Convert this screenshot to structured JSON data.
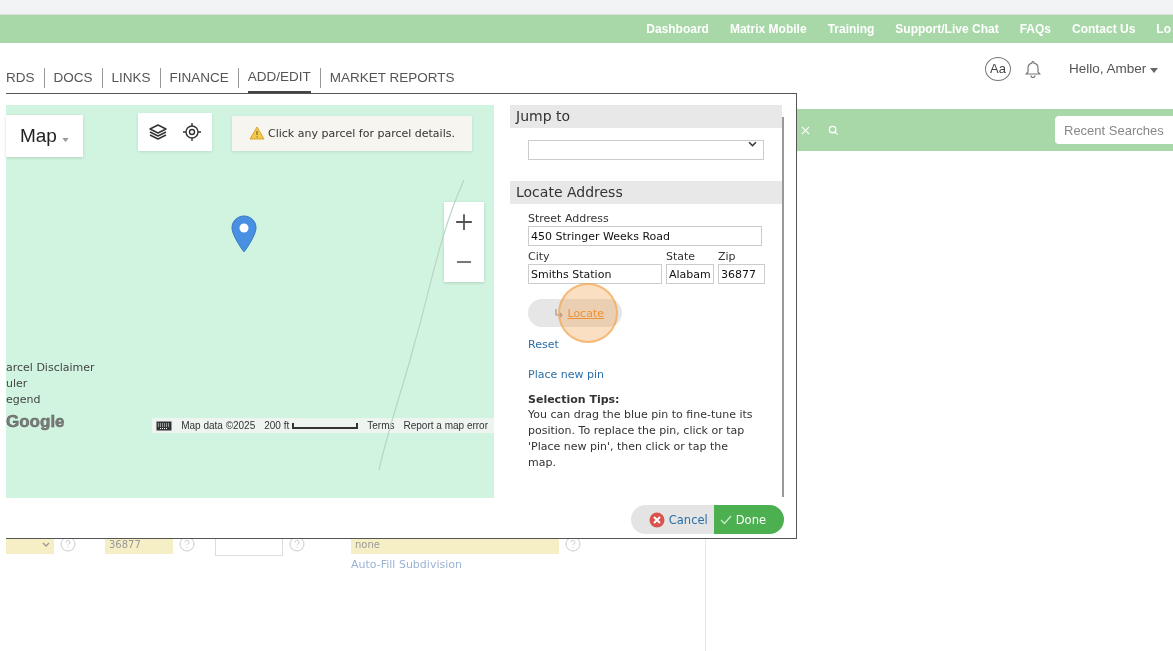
{
  "top_nav": {
    "links": [
      "Dashboard",
      "Matrix Mobile",
      "Training",
      "Support/Live Chat",
      "FAQs",
      "Contact Us",
      "Lo"
    ]
  },
  "main_tabs": [
    {
      "label": "RDS",
      "selected": false
    },
    {
      "label": "DOCS",
      "selected": false
    },
    {
      "label": "LINKS",
      "selected": false
    },
    {
      "label": "FINANCE",
      "selected": false
    },
    {
      "label": "ADD/EDIT",
      "selected": true
    },
    {
      "label": "MARKET REPORTS",
      "selected": false
    }
  ],
  "user_menu": {
    "font_button": "Aa",
    "greeting": "Hello, Amber"
  },
  "search_bar": {
    "recent_searches": "Recent Searches"
  },
  "dialog": {
    "map": {
      "type_button": "Map",
      "notice": "Click any parcel for parcel details.",
      "links": [
        "arcel Disclaimer",
        "uler",
        "egend"
      ],
      "logo": "Google",
      "attribution": "Map data ©2025",
      "scale": "200 ft",
      "terms": "Terms",
      "report": "Report a map error"
    },
    "panel": {
      "jump_heading": "Jump to",
      "locate_heading": "Locate Address",
      "street_label": "Street Address",
      "street": "450 Stringer Weeks Road",
      "city_label": "City",
      "city": "Smiths Station",
      "state_label": "State",
      "state": "Alabam",
      "zip_label": "Zip",
      "zip": "36877",
      "locate_button": "Locate",
      "reset": "Reset",
      "place_pin": "Place new pin",
      "tips_title": "Selection Tips:",
      "tips_text": "You can drag the blue pin to fine-tune its position. To replace the pin, click or tap 'Place new pin', then click or tap the map."
    },
    "cancel": "Cancel",
    "done": "Done"
  },
  "form_row": {
    "zip": "36877",
    "subdivision": "none",
    "autofill_link": "Auto-Fill Subdivision"
  }
}
